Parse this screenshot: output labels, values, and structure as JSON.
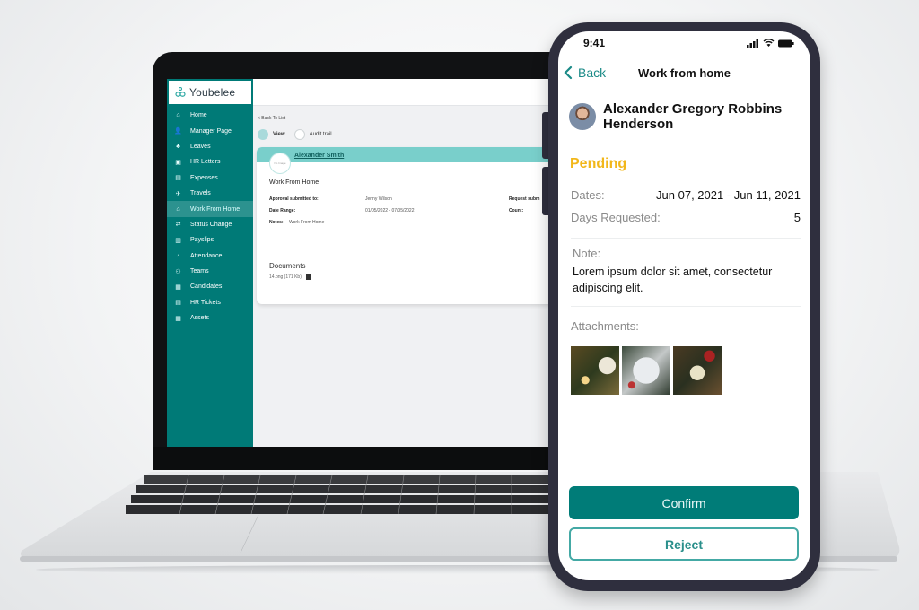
{
  "laptop": {
    "brand": "Youbelee",
    "sidebar": {
      "items": [
        {
          "label": "Home",
          "icon": "home-icon",
          "glyph": "⌂",
          "active": false
        },
        {
          "label": "Manager Page",
          "icon": "user-check-icon",
          "glyph": "👤",
          "active": false
        },
        {
          "label": "Leaves",
          "icon": "leaves-icon",
          "glyph": "♣",
          "active": false
        },
        {
          "label": "HR Letters",
          "icon": "id-card-icon",
          "glyph": "▣",
          "active": false
        },
        {
          "label": "Expenses",
          "icon": "receipt-icon",
          "glyph": "▤",
          "active": false
        },
        {
          "label": "Travels",
          "icon": "plane-icon",
          "glyph": "✈",
          "active": false
        },
        {
          "label": "Work From Home",
          "icon": "home-work-icon",
          "glyph": "⌂",
          "active": true
        },
        {
          "label": "Status Change",
          "icon": "status-change-icon",
          "glyph": "⇄",
          "active": false
        },
        {
          "label": "Payslips",
          "icon": "document-icon",
          "glyph": "▥",
          "active": false
        },
        {
          "label": "Attendance",
          "icon": "attendance-icon",
          "glyph": "◔",
          "active": false
        },
        {
          "label": "Teams",
          "icon": "teams-icon",
          "glyph": "⚇",
          "active": false
        },
        {
          "label": "Candidates",
          "icon": "candidates-icon",
          "glyph": "▦",
          "active": false
        },
        {
          "label": "HR Tickets",
          "icon": "ticket-icon",
          "glyph": "▤",
          "active": false
        },
        {
          "label": "Assets",
          "icon": "assets-icon",
          "glyph": "▦",
          "active": false
        }
      ]
    },
    "main": {
      "back_link": "< Back To List",
      "tabs": [
        {
          "label": "View",
          "selected": true
        },
        {
          "label": "Audit trail",
          "selected": false
        }
      ],
      "card": {
        "avatar_text": "No Image",
        "employee_name": "Alexander Smith",
        "title": "Work From Home",
        "approval_label": "Approval submitted to:",
        "approval_value": "Jenny Wilson",
        "request_label": "Request subm",
        "date_range_label": "Date Range:",
        "date_range_value": "01/05/2022 - 07/05/2022",
        "count_label": "Count:",
        "notes_label": "Notes:",
        "notes_value": "Work From Home",
        "documents_title": "Documents",
        "document_file": "14.png (171 Kb)"
      }
    }
  },
  "phone": {
    "status_bar": {
      "time": "9:41"
    },
    "nav": {
      "back_label": "Back",
      "title": "Work from home"
    },
    "employee_name": "Alexander Gregory Robbins Henderson",
    "status": "Pending",
    "status_color": "#f2b71a",
    "dates_label": "Dates:",
    "dates_value": "Jun 07, 2021 - Jun 11, 2021",
    "days_label": "Days Requested:",
    "days_value": "5",
    "note_label": "Note:",
    "note_text": "Lorem ipsum dolor sit amet, consectetur adipiscing elit.",
    "attachments_label": "Attachments:",
    "attachments": [
      "attachment-1",
      "attachment-2",
      "attachment-3"
    ],
    "confirm_label": "Confirm",
    "reject_label": "Reject",
    "accent_color": "#007c78"
  }
}
